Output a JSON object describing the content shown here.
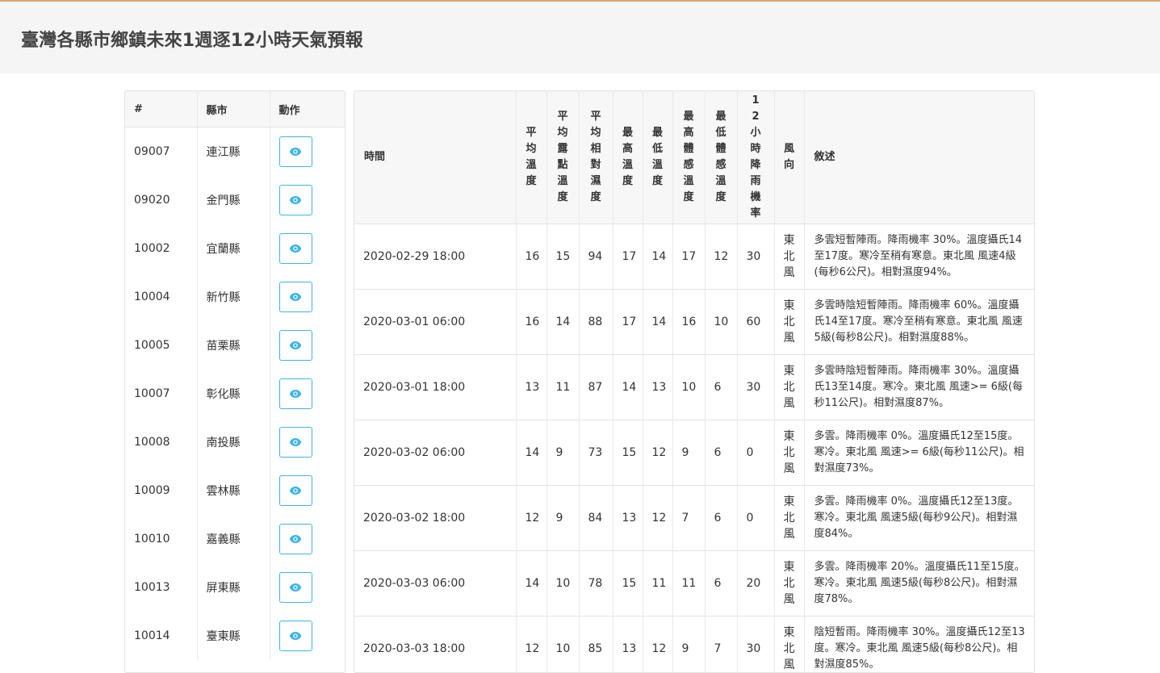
{
  "page": {
    "title": "臺灣各縣市鄉鎮未來1週逐12小時天氣預報"
  },
  "colors": {
    "accent": "#3cb4e6",
    "topline": "#d6a96a",
    "header_bg": "#f5f5f5"
  },
  "city_table": {
    "headers": [
      "#",
      "縣市",
      "動作"
    ],
    "action_icon": "eye-icon",
    "rows": [
      {
        "id": "09007",
        "name": "連江縣"
      },
      {
        "id": "09020",
        "name": "金門縣"
      },
      {
        "id": "10002",
        "name": "宜蘭縣"
      },
      {
        "id": "10004",
        "name": "新竹縣"
      },
      {
        "id": "10005",
        "name": "苗栗縣"
      },
      {
        "id": "10007",
        "name": "彰化縣"
      },
      {
        "id": "10008",
        "name": "南投縣"
      },
      {
        "id": "10009",
        "name": "雲林縣"
      },
      {
        "id": "10010",
        "name": "嘉義縣"
      },
      {
        "id": "10013",
        "name": "屏東縣"
      },
      {
        "id": "10014",
        "name": "臺東縣"
      }
    ]
  },
  "forecast_table": {
    "headers": {
      "time": "時間",
      "avg_temp": "平均溫度",
      "avg_dew": "平均露點溫度",
      "avg_rh": "平均相對濕度",
      "max_temp": "最高溫度",
      "min_temp": "最低溫度",
      "max_at": "最高體感溫度",
      "min_at": "最低體感溫度",
      "pop": "12小時降雨機率",
      "wind": "風向",
      "desc": "敘述"
    },
    "rows": [
      {
        "time": "2020-02-29 18:00",
        "avg_temp": "16",
        "avg_dew": "15",
        "avg_rh": "94",
        "max_temp": "17",
        "min_temp": "14",
        "max_at": "17",
        "min_at": "12",
        "pop": "30",
        "wind": "東北風",
        "desc": "多雲短暫陣雨。降雨機率 30%。溫度攝氏14至17度。寒冷至稍有寒意。東北風 風速4級(每秒6公尺)。相對濕度94%。"
      },
      {
        "time": "2020-03-01 06:00",
        "avg_temp": "16",
        "avg_dew": "14",
        "avg_rh": "88",
        "max_temp": "17",
        "min_temp": "14",
        "max_at": "16",
        "min_at": "10",
        "pop": "60",
        "wind": "東北風",
        "desc": "多雲時陰短暫陣雨。降雨機率 60%。溫度攝氏14至17度。寒冷至稍有寒意。東北風 風速5級(每秒8公尺)。相對濕度88%。"
      },
      {
        "time": "2020-03-01 18:00",
        "avg_temp": "13",
        "avg_dew": "11",
        "avg_rh": "87",
        "max_temp": "14",
        "min_temp": "13",
        "max_at": "10",
        "min_at": "6",
        "pop": "30",
        "wind": "東北風",
        "desc": "多雲時陰短暫陣雨。降雨機率 30%。溫度攝氏13至14度。寒冷。東北風 風速>= 6級(每秒11公尺)。相對濕度87%。"
      },
      {
        "time": "2020-03-02 06:00",
        "avg_temp": "14",
        "avg_dew": "9",
        "avg_rh": "73",
        "max_temp": "15",
        "min_temp": "12",
        "max_at": "9",
        "min_at": "6",
        "pop": "0",
        "wind": "東北風",
        "desc": "多雲。降雨機率 0%。溫度攝氏12至15度。寒冷。東北風 風速>= 6級(每秒11公尺)。相對濕度73%。"
      },
      {
        "time": "2020-03-02 18:00",
        "avg_temp": "12",
        "avg_dew": "9",
        "avg_rh": "84",
        "max_temp": "13",
        "min_temp": "12",
        "max_at": "7",
        "min_at": "6",
        "pop": "0",
        "wind": "東北風",
        "desc": "多雲。降雨機率 0%。溫度攝氏12至13度。寒冷。東北風 風速5級(每秒9公尺)。相對濕度84%。"
      },
      {
        "time": "2020-03-03 06:00",
        "avg_temp": "14",
        "avg_dew": "10",
        "avg_rh": "78",
        "max_temp": "15",
        "min_temp": "11",
        "max_at": "11",
        "min_at": "6",
        "pop": "20",
        "wind": "東北風",
        "desc": "多雲。降雨機率 20%。溫度攝氏11至15度。寒冷。東北風 風速5級(每秒8公尺)。相對濕度78%。"
      },
      {
        "time": "2020-03-03 18:00",
        "avg_temp": "12",
        "avg_dew": "10",
        "avg_rh": "85",
        "max_temp": "13",
        "min_temp": "12",
        "max_at": "9",
        "min_at": "7",
        "pop": "30",
        "wind": "東北風",
        "desc": "陰短暫雨。降雨機率 30%。溫度攝氏12至13度。寒冷。東北風 風速5級(每秒8公尺)。相對濕度85%。"
      }
    ]
  }
}
